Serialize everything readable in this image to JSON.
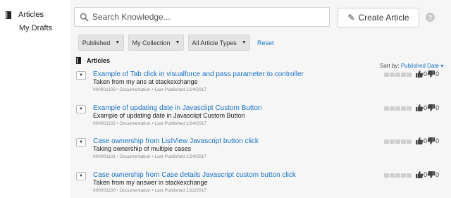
{
  "nav": {
    "articles_label": "Articles",
    "drafts_label": "My Drafts"
  },
  "search": {
    "placeholder": "Search Knowledge...",
    "value": ""
  },
  "create_button_label": "Create Article",
  "help_label": "?",
  "filters": {
    "status_label": "Published",
    "collection_label": "My Collection",
    "types_label": "All Article Types",
    "reset_label": "Reset"
  },
  "list": {
    "heading": "Articles",
    "sort_label": "Sort by:",
    "sort_value": "Published Date",
    "rows": [
      {
        "title": "Example of Tab click in visualforce and pass parameter to controller",
        "summary": "Taken from my ans at stackexchange",
        "meta": "000001103 • Documentation • Last Published 1/24/2017",
        "likes": "0",
        "dislikes": "0"
      },
      {
        "title": "Example of updating date in Javasciipt Custom Button",
        "summary": "Example of updating date in Javasciipt Custom Button",
        "meta": "000001102 • Documentation • Last Published 1/24/2017",
        "likes": "0",
        "dislikes": "0"
      },
      {
        "title": "Case ownership from ListView Javascript button click",
        "summary": "Taking ownership of multiple cases",
        "meta": "000001101 • Documentation • Last Published 1/24/2017",
        "likes": "0",
        "dislikes": "0"
      },
      {
        "title": "Case ownership from Case details Javascript custom button click",
        "summary": "Taken from my answer in stackexchange",
        "meta": "000001100 • Documentation • Last Published 1/22/2017",
        "likes": "0",
        "dislikes": "0"
      }
    ]
  },
  "colors": {
    "link": "#1a73c8",
    "panel_bg": "#f6f6f6",
    "button_bg": "#e4e4e4"
  }
}
